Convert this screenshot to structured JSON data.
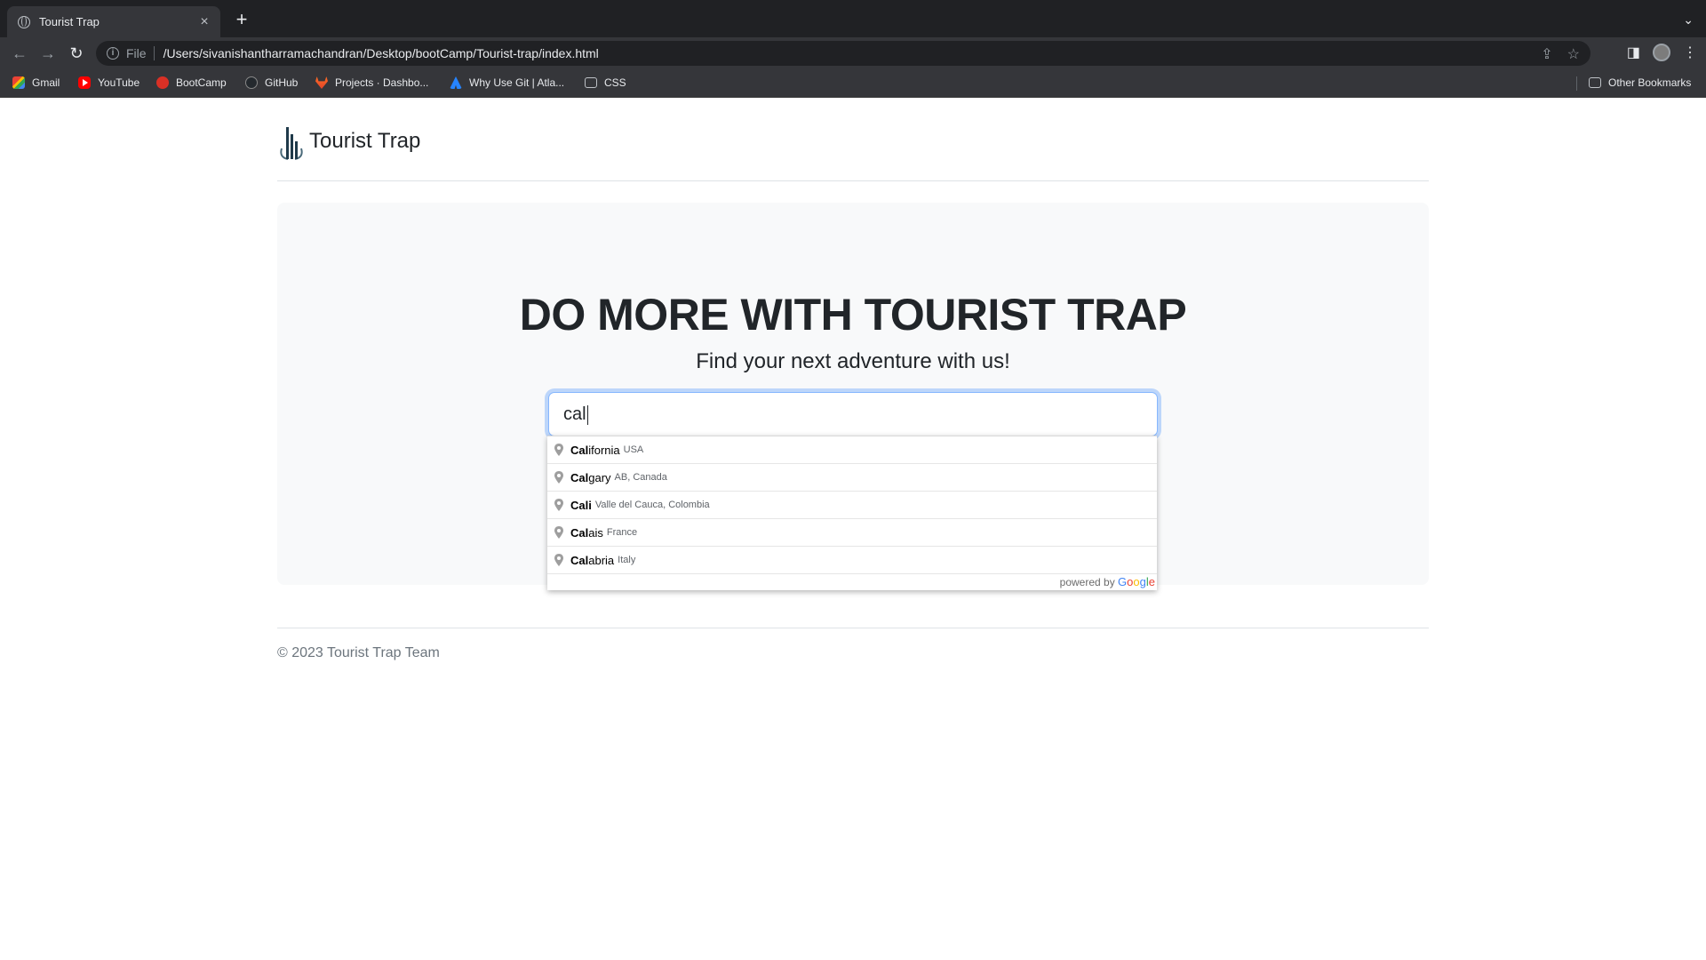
{
  "browser": {
    "tab_title": "Tourist Trap",
    "url_scheme": "File",
    "url": "/Users/sivanishantharramachandran/Desktop/bootCamp/Tourist-trap/index.html",
    "bookmarks": [
      "Gmail",
      "YouTube",
      "BootCamp",
      "GitHub",
      "Projects · Dashbo...",
      "Why Use Git | Atla...",
      "CSS"
    ],
    "other_bookmarks": "Other Bookmarks"
  },
  "site": {
    "brand": "Tourist Trap",
    "hero_title": "DO MORE WITH TOURIST TRAP",
    "hero_subtitle": "Find your next adventure with us!",
    "search_value": "cal",
    "footer": "© 2023 Tourist Trap Team"
  },
  "autocomplete": {
    "items": [
      {
        "match": "Cal",
        "rest": "ifornia",
        "secondary": "USA"
      },
      {
        "match": "Cal",
        "rest": "gary",
        "secondary": "AB, Canada"
      },
      {
        "match": "Cali",
        "rest": "",
        "secondary": "Valle del Cauca, Colombia"
      },
      {
        "match": "Cal",
        "rest": "ais",
        "secondary": "France"
      },
      {
        "match": "Cal",
        "rest": "abria",
        "secondary": "Italy"
      }
    ],
    "powered_by": "powered by",
    "google": "Google"
  },
  "colors": {
    "chrome_dark": "#202124",
    "chrome_toolbar": "#35363a",
    "hero_bg": "#f8f9fa",
    "focus_ring": "#86b7fe"
  }
}
